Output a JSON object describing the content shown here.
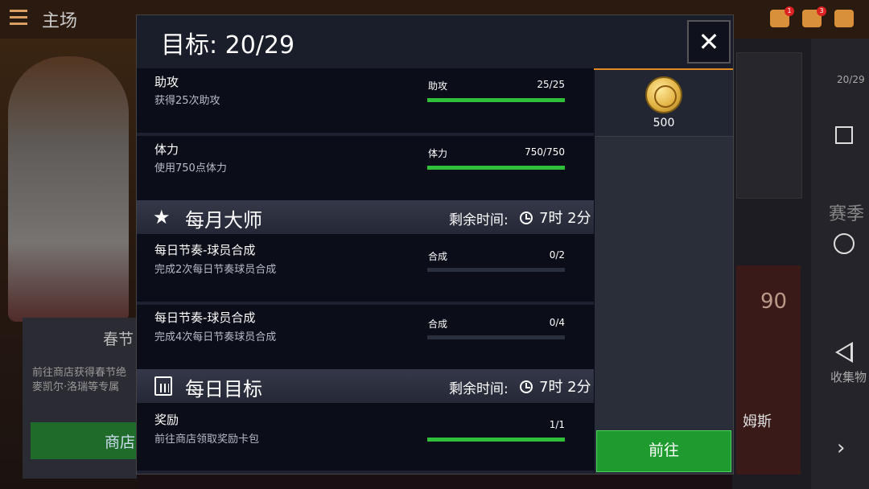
{
  "header": {
    "title": "主场"
  },
  "background": {
    "card_title": "春节",
    "card_desc_line1": "前往商店获得春节绝",
    "card_desc_line2": "麥凯尔·洛瑞等专属",
    "card_button": "商店",
    "side_progress": "20/29",
    "side_season": "赛季",
    "side_collect": "收集物",
    "player_rating": "90",
    "player_name": "姆斯"
  },
  "dialog": {
    "title": "目标: 20/29",
    "close_glyph": "✕",
    "reward": {
      "amount": "500",
      "icon": "basketball-coin-icon"
    },
    "go_button": "前往",
    "tasks_top": [
      {
        "name": "助攻",
        "desc": "获得25次助攻",
        "progress_label": "助攻",
        "progress_value": "25/25",
        "fraction": 1.0
      },
      {
        "name": "体力",
        "desc": "使用750点体力",
        "progress_label": "体力",
        "progress_value": "750/750",
        "fraction": 1.0
      }
    ],
    "monthly": {
      "title": "每月大师",
      "time_label": "剩余时间:",
      "time_value": "7时 2分",
      "tasks": [
        {
          "name": "每日节奏-球员合成",
          "desc": "完成2次每日节奏球员合成",
          "progress_label": "合成",
          "progress_value": "0/2",
          "fraction": 0.0
        },
        {
          "name": "每日节奏-球员合成",
          "desc": "完成4次每日节奏球员合成",
          "progress_label": "合成",
          "progress_value": "0/4",
          "fraction": 0.0
        }
      ]
    },
    "daily": {
      "title": "每日目标",
      "time_label": "剩余时间:",
      "time_value": "7时 2分",
      "tasks": [
        {
          "name": "奖励",
          "desc": "前往商店领取奖励卡包",
          "progress_label": "",
          "progress_value": "1/1",
          "fraction": 1.0
        }
      ]
    }
  },
  "notifications": {
    "badge1": "1",
    "badge2": "3"
  }
}
